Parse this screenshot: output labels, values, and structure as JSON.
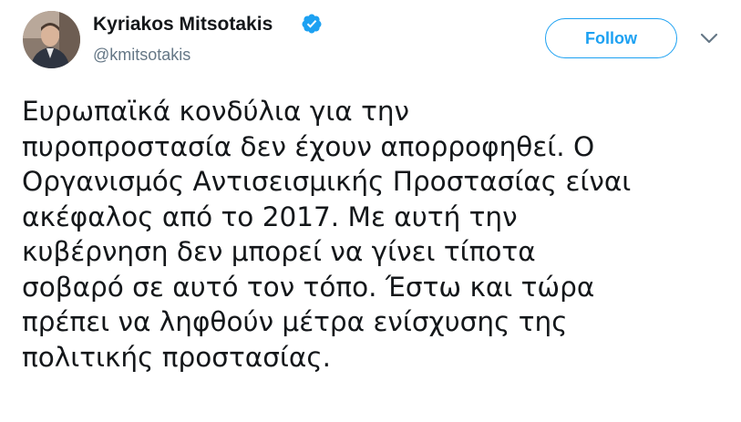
{
  "tweet": {
    "author": {
      "name": "Kyriakos Mitsotakis",
      "handle": "@kmitsotakis",
      "verified": true,
      "avatar_icon": "profile-photo"
    },
    "follow_label": "Follow",
    "menu_icon": "chevron-down-icon",
    "text_lines": [
      "Ευρωπαϊκά κονδύλια για την",
      "πυροπροστασία δεν έχουν απορροφηθεί. Ο",
      "Οργανισμός Αντισεισμικής Προστασίας είναι",
      "ακέφαλος από το 2017. Με αυτή την",
      "κυβέρνηση δεν μπορεί να γίνει τίποτα",
      "σοβαρό σε αυτό τον τόπο. Έστω και τώρα",
      "πρέπει να ληφθούν μέτρα ενίσχυσης της",
      "πολιτικής προστασίας."
    ]
  },
  "colors": {
    "accent": "#1da1f2",
    "text": "#14171a",
    "secondary_text": "#657786",
    "background": "#ffffff"
  }
}
